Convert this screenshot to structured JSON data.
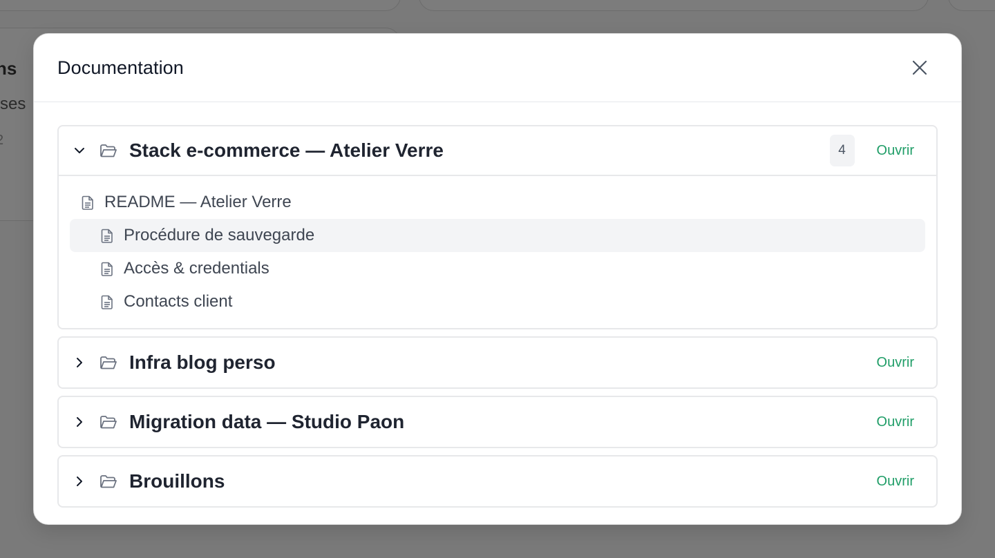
{
  "background": {
    "heading": "ns",
    "subtext": "rses",
    "meta": "2"
  },
  "modal": {
    "title": "Documentation",
    "close_icon": "close-icon"
  },
  "folders": [
    {
      "name": "Stack e-commerce — Atelier Verre",
      "count": "4",
      "open_label": "Ouvrir",
      "expanded": true,
      "docs": [
        {
          "title": "README — Atelier Verre",
          "level": 0,
          "active": false
        },
        {
          "title": "Procédure de sauvegarde",
          "level": 1,
          "active": true
        },
        {
          "title": "Accès & credentials",
          "level": 1,
          "active": false
        },
        {
          "title": "Contacts client",
          "level": 1,
          "active": false
        }
      ]
    },
    {
      "name": "Infra blog perso",
      "open_label": "Ouvrir",
      "expanded": false
    },
    {
      "name": "Migration data — Studio Paon",
      "open_label": "Ouvrir",
      "expanded": false
    },
    {
      "name": "Brouillons",
      "open_label": "Ouvrir",
      "expanded": false
    }
  ],
  "colors": {
    "accent": "#1f9d67",
    "overlay": "#7a7a7a",
    "active_row": "#f3f4f6"
  }
}
